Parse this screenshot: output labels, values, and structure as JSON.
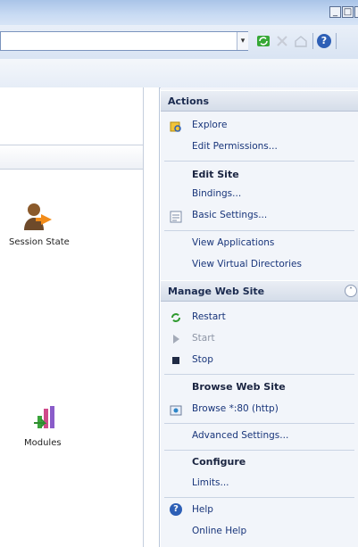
{
  "window": {
    "controls": [
      "_",
      "□"
    ]
  },
  "address_bar": {
    "value": "",
    "dropdown_glyph": "▾"
  },
  "toolbar": {
    "icons": [
      "refresh-icon",
      "stop-icon",
      "home-icon",
      "help-icon"
    ],
    "help_glyph": "?"
  },
  "content": {
    "features": [
      {
        "label": "Session State",
        "icon": "session-state-icon"
      },
      {
        "label": "Modules",
        "icon": "modules-icon"
      }
    ]
  },
  "actions": {
    "header": "Actions",
    "explore": "Explore",
    "edit_permissions": "Edit Permissions...",
    "edit_site": "Edit Site",
    "bindings": "Bindings...",
    "basic_settings": "Basic Settings...",
    "view_applications": "View Applications",
    "view_virtual_directories": "View Virtual Directories",
    "manage_header": "Manage Web Site",
    "collapse_glyph": "˄",
    "restart": "Restart",
    "start": "Start",
    "stop": "Stop",
    "browse_header": "Browse Web Site",
    "browse": "Browse *:80 (http)",
    "advanced_settings": "Advanced Settings...",
    "configure": "Configure",
    "limits": "Limits...",
    "help": "Help",
    "online_help": "Online Help"
  },
  "colors": {
    "link": "#18357a",
    "actions_bg": "#f2f5fa",
    "header_bg": "#d5dde9",
    "restart_green": "#2f9a2f"
  }
}
